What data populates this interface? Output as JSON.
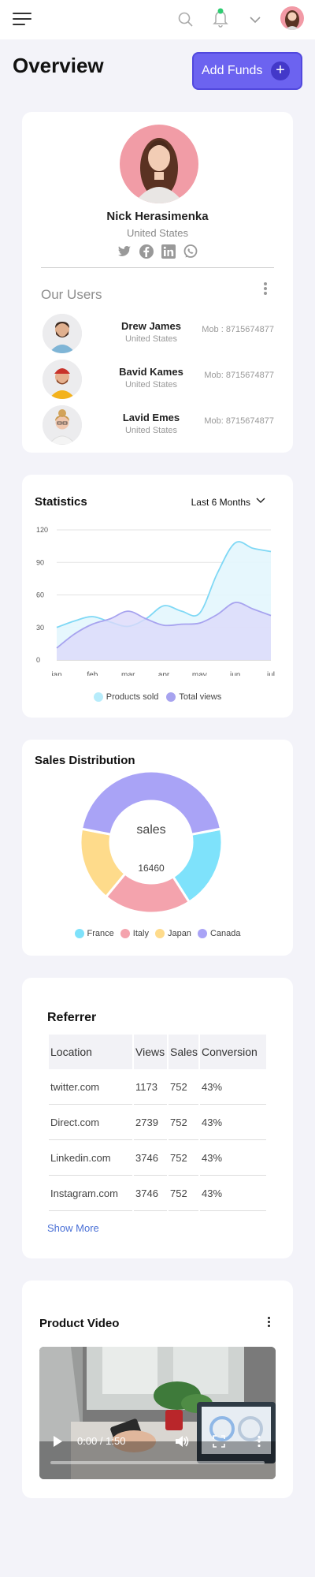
{
  "header": {
    "menu_icon": "hamburger-icon",
    "search_icon": "search-icon",
    "bell_icon": "bell-icon",
    "chevron_icon": "chevron-down-icon",
    "notification_color": "#2ecc71"
  },
  "page": {
    "title": "Overview",
    "add_funds_label": "Add Funds",
    "add_funds_icon": "+",
    "accent": "#6c63f0"
  },
  "profile": {
    "name": "Nick Herasimenka",
    "country": "United States",
    "socials": [
      "twitter-icon",
      "facebook-icon",
      "linkedin-icon",
      "whatsapp-icon"
    ]
  },
  "users": {
    "title": "Our Users",
    "items": [
      {
        "name": "Drew James",
        "country": "United States",
        "mob": "Mob : 8715674877"
      },
      {
        "name": "Bavid Kames",
        "country": "United States",
        "mob": "Mob: 8715674877"
      },
      {
        "name": "Lavid Emes",
        "country": "United States",
        "mob": "Mob: 8715674877"
      }
    ]
  },
  "statistics": {
    "title": "Statistics",
    "range": "Last 6 Months"
  },
  "sales": {
    "title": "Sales Distribution",
    "center_label": "sales",
    "center_value": "16460"
  },
  "referrer": {
    "title": "Referrer",
    "columns": [
      "Location",
      "Views",
      "Sales",
      "Conversion"
    ],
    "rows": [
      [
        "twitter.com",
        "1173",
        "752",
        "43%"
      ],
      [
        "Direct.com",
        "2739",
        "752",
        "43%"
      ],
      [
        "Linkedin.com",
        "3746",
        "752",
        "43%"
      ],
      [
        "Instagram.com",
        "3746",
        "752",
        "43%"
      ]
    ],
    "show_more": "Show More"
  },
  "video": {
    "title": "Product Video",
    "time": "0:00 / 1:50",
    "progress": 0
  },
  "chart_data": [
    {
      "type": "area",
      "categories": [
        "jan",
        "feb",
        "mar",
        "apr",
        "may",
        "jun",
        "jul"
      ],
      "x": [
        0,
        0.5,
        1,
        1.5,
        2,
        2.5,
        3,
        3.5,
        4,
        4.5,
        5,
        5.5,
        6
      ],
      "ylim": [
        0,
        120
      ],
      "yticks": [
        0,
        30,
        60,
        90,
        120
      ],
      "grid": true,
      "legend_position": "bottom",
      "series": [
        {
          "name": "Products sold",
          "color": "#7fd8f5",
          "fill": "#e3f6fd",
          "values": [
            30,
            36,
            40,
            35,
            31,
            38,
            50,
            45,
            43,
            80,
            108,
            103,
            100
          ]
        },
        {
          "name": "Total views",
          "color": "#a7a3ef",
          "fill": "#dcdafa",
          "values": [
            11,
            24,
            33,
            38,
            45,
            38,
            32,
            33,
            34,
            42,
            53,
            47,
            41
          ]
        }
      ]
    },
    {
      "type": "pie",
      "donut": true,
      "legend_position": "bottom",
      "categories": [
        "France",
        "Italy",
        "Japan",
        "Canada"
      ],
      "colors": [
        "#7ee2fb",
        "#f4a3ad",
        "#fedb8b",
        "#a9a3f6"
      ],
      "values": [
        19,
        20,
        17,
        44
      ]
    }
  ]
}
